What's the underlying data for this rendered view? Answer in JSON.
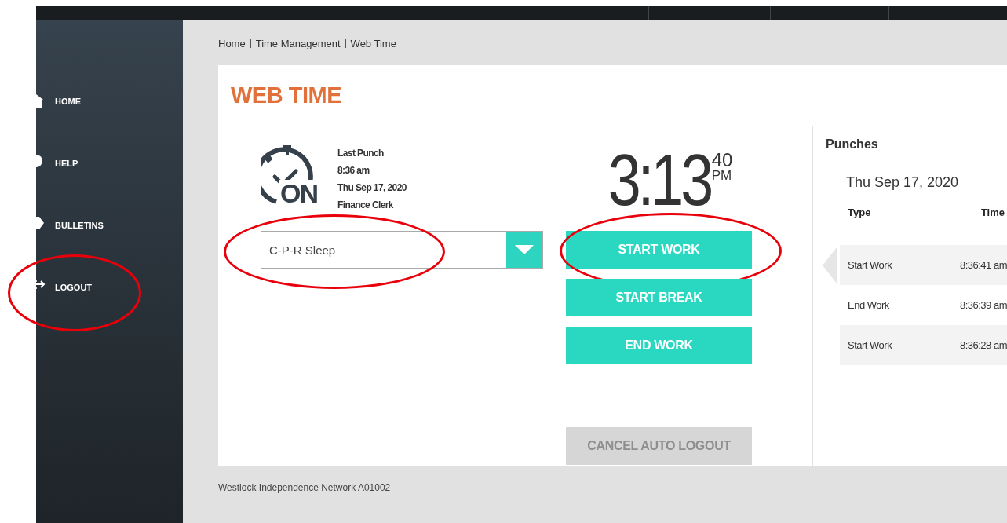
{
  "sidebar": {
    "items": [
      {
        "label": "HOME",
        "kind": "home",
        "circled": false
      },
      {
        "label": "HELP",
        "kind": "help",
        "circled": false
      },
      {
        "label": "BULLETINS",
        "kind": "bulletins",
        "circled": false
      },
      {
        "label": "LOGOUT",
        "kind": "logout",
        "circled": true
      }
    ]
  },
  "breadcrumb": [
    "Home",
    "Time Management",
    "Web Time"
  ],
  "page_title": "WEB TIME",
  "last_punch": [
    "Last Punch",
    "8:36 am",
    "Thu Sep 17, 2020",
    "Finance Clerk"
  ],
  "status_badge": "ON",
  "clock": {
    "time": "3:13",
    "seconds": "40",
    "period": "PM"
  },
  "dropdown": {
    "value": "C-P-R Sleep",
    "circled": true
  },
  "punch_buttons": [
    {
      "label": "START WORK",
      "circled": true
    },
    {
      "label": "START BREAK",
      "circled": false
    },
    {
      "label": "END WORK",
      "circled": false
    }
  ],
  "cancel_button": {
    "label": "CANCEL AUTO LOGOUT",
    "disabled": true
  },
  "punches": {
    "title": "Punches",
    "date": "Thu Sep 17, 2020",
    "columns": [
      "Type",
      "Time"
    ],
    "rows": [
      {
        "type": "Start Work",
        "time": "8:36:41 am",
        "selected": true
      },
      {
        "type": "End Work",
        "time": "8:36:39 am",
        "selected": false
      },
      {
        "type": "Start Work",
        "time": "8:36:28 am",
        "selected": false
      }
    ]
  },
  "footer": "Westlock Independence Network A01002"
}
